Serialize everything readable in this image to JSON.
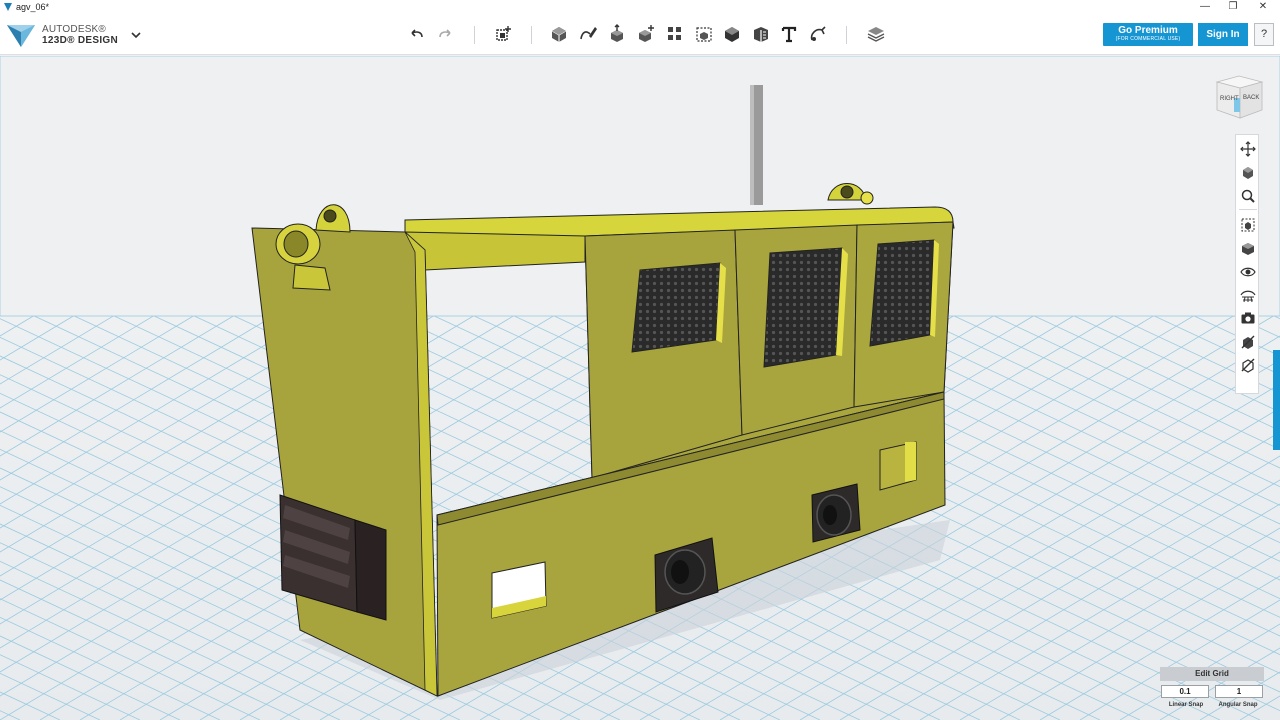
{
  "window": {
    "title": "agv_06*",
    "minimize": "—",
    "maximize": "❐",
    "close": "✕"
  },
  "brand": {
    "line1": "AUTODESK®",
    "line2": "123D® DESIGN"
  },
  "toolbar": {
    "tools": [
      "undo-icon",
      "redo-icon",
      "transform-icon",
      "primitives-icon",
      "sketch-icon",
      "construct-icon",
      "modify-icon",
      "pattern-icon",
      "group-icon",
      "combine-icon",
      "measure-icon",
      "text-icon",
      "snap-icon",
      "material-icon"
    ]
  },
  "account": {
    "premium_label": "Go Premium",
    "premium_sub": "(FOR COMMERCIAL USE)",
    "signin_label": "Sign In",
    "help_label": "?"
  },
  "viewcube": {
    "left_face": "RIGHT",
    "right_face": "BACK"
  },
  "grid": {
    "edit_label": "Edit Grid",
    "linear_snap_value": "0.1",
    "angular_snap_value": "1",
    "linear_snap_label": "Linear Snap",
    "angular_snap_label": "Angular Snap"
  },
  "colors": {
    "accent": "#1596d3",
    "model_body": "#a9a53e",
    "model_light": "#d4d33c",
    "grid_line": "#8fc6df"
  }
}
